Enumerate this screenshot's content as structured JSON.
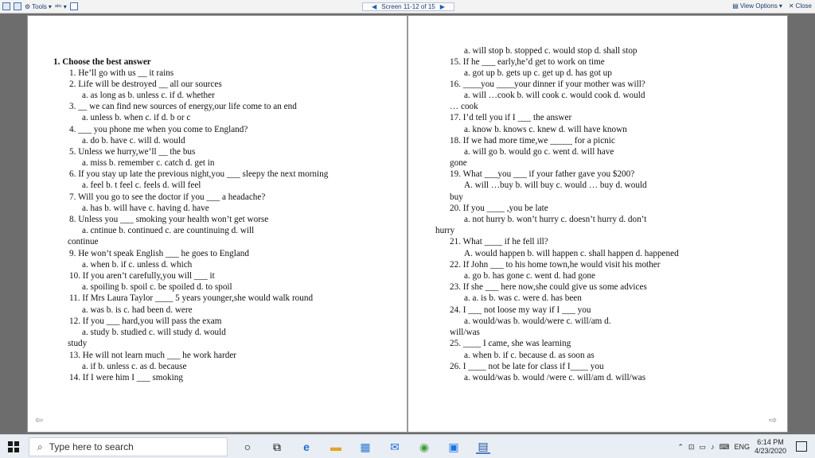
{
  "toolbar": {
    "tools_label": "Tools",
    "nav_label": "Screen 11-12 of 15",
    "view_options_label": "View Options",
    "close_label": "Close",
    "accent_color": "#1f5fb8"
  },
  "left_page": {
    "lines": [
      "1. Choose the best answer",
      "1.  He’ll go with us __ it rains",
      "2.  Life will be destroyed __ all our sources",
      "a. as long as          b. unless               c. if          d. whether",
      "3. __ we can find new sources of energy,our life come to an end",
      "a. unless               b. when                 c. if          d. b or c",
      "4. ___ you phone me when you come to England?",
      "a. do                   b. have                 c. will                  d. would",
      "5.  Unless we hurry,we’ll __ the bus",
      "a. miss                 b. remember             c. catch    d. get in",
      "6.  If you stay up late the previous night,you ___ sleepy the next morning",
      "a. feel                 b. t feel               c. feels   d. will feel",
      "7.  Will you go to see the doctor if you ___ a headache?",
      "a. has                  b. will have            c. having  d. have",
      "8.  Unless you ___ smoking your health won’t get worse",
      "a. cntinue              b. continued            c. are countinuing    d. will",
      "continue",
      "9.  He won’t speak English ___ he goes to England",
      "a. when           b. if               c. unless            d. which",
      "10. If you aren’t carefully,you will ___ it",
      "a. spoiling            b. spoil               c. be spoiled          d. to spoil",
      "11. If Mrs Laura Taylor ____ 5 years younger,she would walk round",
      "a. was                  b. is                  c. had been            d. were",
      "12. If you ___ hard,you will pass the exam",
      "a. study           b. studied              c. will study          d. would",
      "study",
      "13. He will not learn much ___ he work harder",
      "a. if                   b. unless              c. as                  d. because",
      "14. If I were him I ___ smoking"
    ]
  },
  "right_page": {
    "lines": [
      "a. will stop             b. stopped                c. would stop    d. shall stop",
      "15. If he ___ early,he’d get to work on time",
      "a. got up                b. gets up            c. get up              d. has got up",
      "16. ____you ____your dinner if your mother was will?",
      "a. will …cook            b. will cook              c. would cook          d. would",
      "… cook",
      "17. I’d tell you if I ___ the answer",
      "a. know            b. knows               c. knew               d. will have known",
      "18. If we had more time,we _____ for a picnic",
      "a. will go               b. would go               c. went                d. will have",
      "gone",
      "19. What ___you ___ if your father gave you $200?",
      "A. will …buy            b. will buy               c. would … buy        d. would",
      "buy",
      "20. If you ____ ,you be late",
      "a. not hurry             b. won’t hurry          c. doesn’t hurry      d. don’t",
      "hurry",
      "21. What ____ if he fell ill?",
      "A. would happen    b. will happen   c. shall happen         d. happened",
      "22. If John ___ to his home town,he would visit his mother",
      "a. go                    b. has gone              c. went                d. had gone",
      "23. If she ___ here now,she could give us some advices",
      "a. a. is                 b. was                 c. were               d. has been",
      "24. I ___ not loose my way if I ___ you",
      "a. would/was             b. would/were            c. will/am              d.",
      "will/was",
      "25. ____ I came, she was learning",
      "a. when              b. if                     c. because              d. as soon as",
      "26. I ____ not be late for class if I____ you",
      "a. would/was             b. would /were  c. will/am                  d. will/was"
    ]
  },
  "taskbar": {
    "search_placeholder": "Type here to search",
    "lang": "ENG",
    "time": "6:14 PM",
    "date": "4/23/2020"
  }
}
